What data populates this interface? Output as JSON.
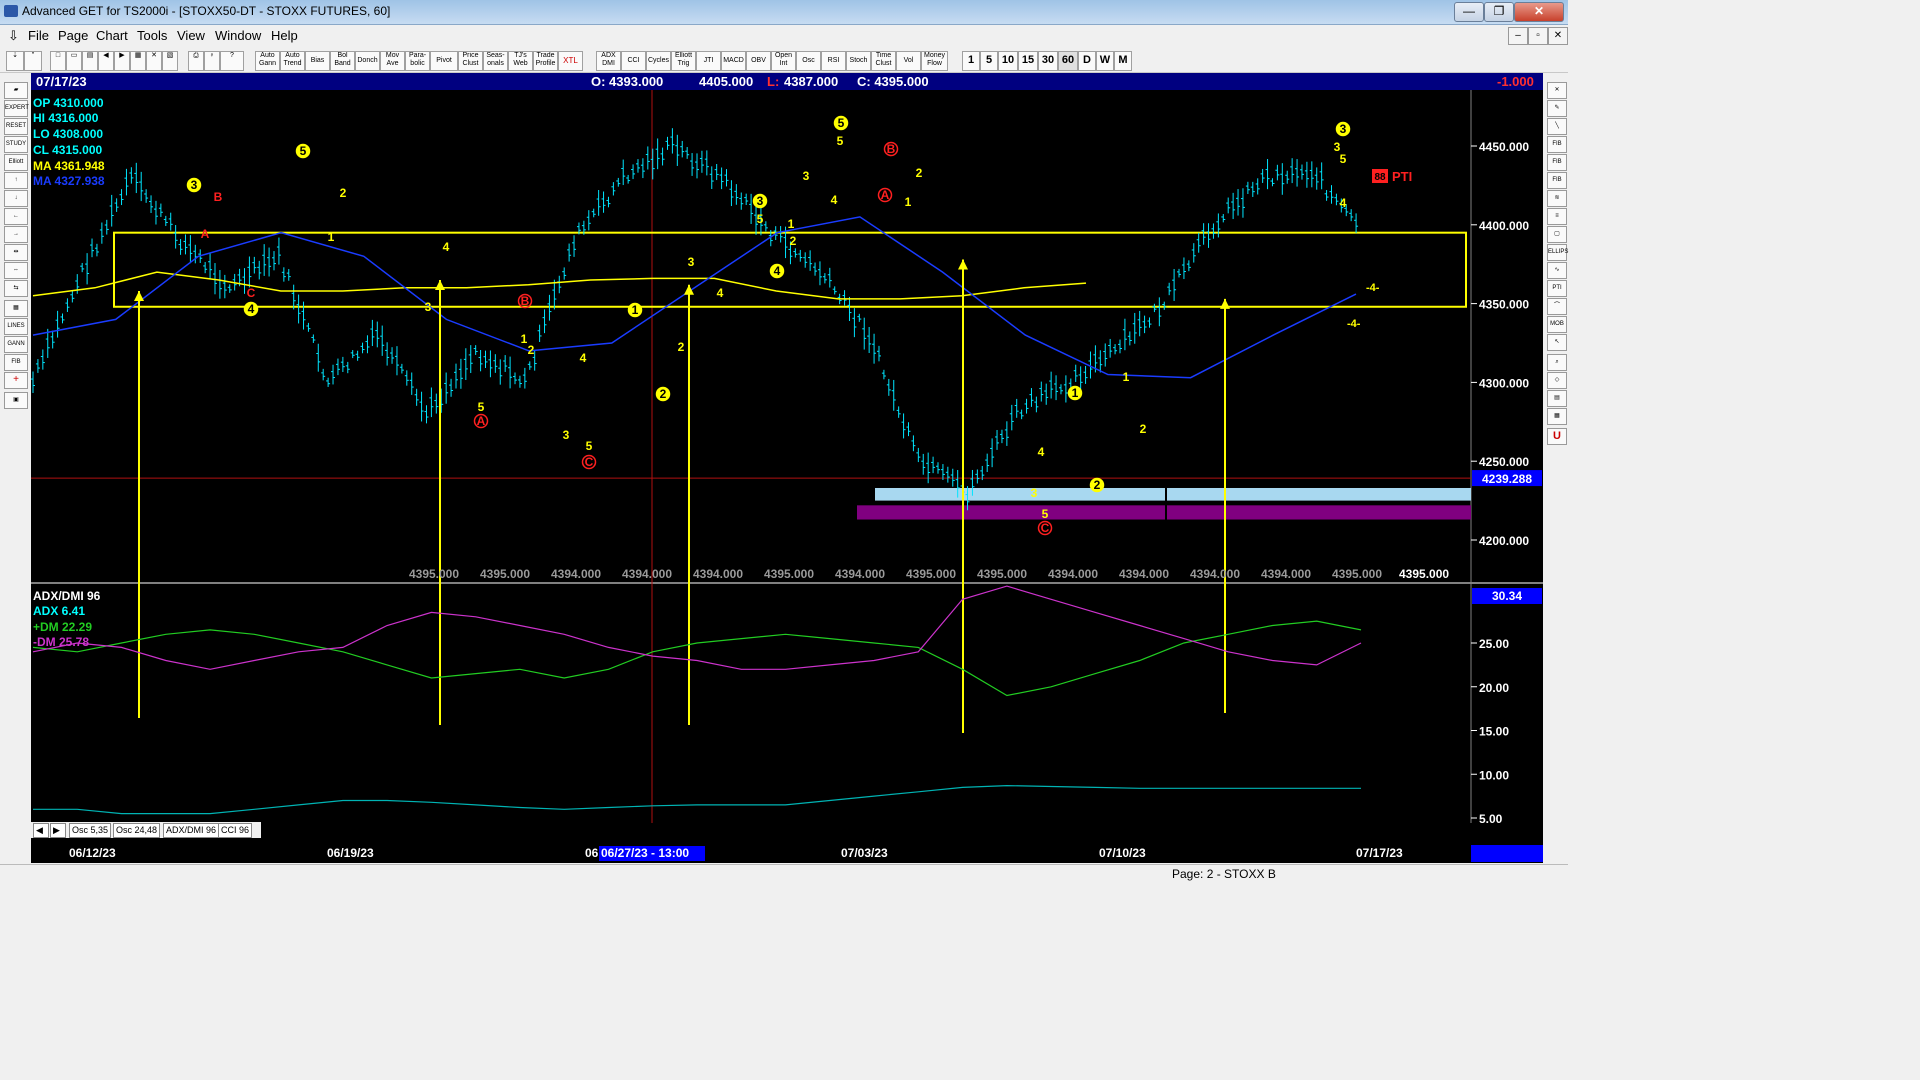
{
  "window": {
    "title": "Advanced GET for TS2000i - [STOXX50-DT - STOXX FUTURES, 60]",
    "minimize": "—",
    "maximize": "❐",
    "close": "✕"
  },
  "menu": [
    "File",
    "Page",
    "Chart",
    "Tools",
    "View",
    "Window",
    "Help"
  ],
  "mdi_controls": [
    "–",
    "▫",
    "✕"
  ],
  "toolbar": {
    "tools": [
      "Auto Gann",
      "Auto Trend",
      "Bias",
      "Bol Band",
      "Donch",
      "Mov Ave",
      "Para-bolic",
      "Pivot",
      "Price Clust",
      "Seas-onals",
      "TJ's Web",
      "Trade Profile",
      "XTL",
      "ADX DMI",
      "CCI",
      "Cycles",
      "Elliott Trig",
      "JTI",
      "MACD",
      "OBV",
      "Open Int",
      "Osc",
      "RSI",
      "Stoch",
      "Time Clust",
      "Vol",
      "Money Flow"
    ],
    "periods": [
      "1",
      "5",
      "10",
      "15",
      "30",
      "60",
      "D",
      "W",
      "M"
    ]
  },
  "left_tools": [
    "EXPERT",
    "RESET",
    "STUDY",
    "Elliott",
    "LINES",
    "GANN",
    "FIB"
  ],
  "right_tools": [
    "FIB RET",
    "FIB EXT",
    "FIB TIME",
    "ELLIPS",
    "PTI",
    "MOB"
  ],
  "infobar": {
    "date": "07/17/23",
    "open": "O: 4393.000",
    "high": "4405.000",
    "low_label": "L:",
    "low": "4387.000",
    "close": "C: 4395.000",
    "change": "-1.000"
  },
  "readout": {
    "op": "OP  4310.000",
    "hi": "HI   4316.000",
    "lo": "LO  4308.000",
    "cl": "CL  4315.000",
    "ma1": "MA  4361.948",
    "ma2": "MA  4327.938"
  },
  "colors": {
    "price_up": "#00e5ff",
    "ma_yellow": "#ffff00",
    "ma_blue": "#1a3cff",
    "plus_dm": "#22cc22",
    "minus_dm": "#cc33cc",
    "adx": "#00b3b3",
    "wave_label": "#ffff00",
    "abc_label": "#ff2020",
    "target_box": "#a8d8f0",
    "target_box2": "#800080"
  },
  "price_axis": {
    "ticks": [
      "4450.000",
      "4400.000",
      "4350.000",
      "4300.000",
      "4250.000",
      "4200.000"
    ],
    "current": "4239.288"
  },
  "bottom_values": [
    "4395.000",
    "4395.000",
    "4394.000",
    "4394.000",
    "4394.000",
    "4395.000",
    "4394.000",
    "4395.000",
    "4395.000",
    "4394.000",
    "4394.000",
    "4394.000",
    "4394.000",
    "4395.000"
  ],
  "bottom_value_last": "4395.000",
  "pti": "88 PTI",
  "adx_panel": {
    "title": "ADX/DMI 96",
    "adx": "ADX 6.41",
    "plus": "+DM 22.29",
    "minus": "-DM 25.78",
    "current": "30.34",
    "ticks": [
      "25.00",
      "20.00",
      "15.00",
      "10.00",
      "5.00"
    ]
  },
  "date_axis": {
    "labels": [
      "06/12/23",
      "06/19/23",
      "06",
      "07/03/23",
      "07/10/23",
      "07/17/23"
    ],
    "cursor": "06/27/23 - 13:00"
  },
  "tabs": [
    "Osc 5,35",
    "Osc 24,48",
    "ADX/DMI 96",
    "CCI 96"
  ],
  "status": "Page: 2 - STOXX B",
  "chart_data": {
    "type": "line",
    "title": "STOXX50-DT - STOXX FUTURES, 60",
    "x": [
      "06/12/23",
      "06/19/23",
      "06/27/23",
      "07/03/23",
      "07/10/23",
      "07/17/23"
    ],
    "ylim": [
      4180,
      4480
    ],
    "series": [
      {
        "name": "price",
        "values": [
          4300,
          4370,
          4430,
          4390,
          4360,
          4380,
          4300,
          4330,
          4280,
          4320,
          4300,
          4390,
          4430,
          4450,
          4430,
          4395,
          4370,
          4330,
          4250,
          4230,
          4280,
          4300,
          4320,
          4350,
          4400,
          4430,
          4435,
          4395
        ]
      },
      {
        "name": "MA 4361.948",
        "values": [
          4355,
          4360,
          4370,
          4365,
          4358,
          4358,
          4360,
          4360,
          4362,
          4365,
          4366,
          4366,
          4358,
          4353,
          4353,
          4355,
          4360,
          4363
        ]
      },
      {
        "name": "MA 4327.938",
        "values": [
          4330,
          4340,
          4380,
          4395,
          4380,
          4340,
          4320,
          4325,
          4360,
          4395,
          4405,
          4370,
          4330,
          4305,
          4303,
          4330,
          4356
        ]
      }
    ]
  }
}
